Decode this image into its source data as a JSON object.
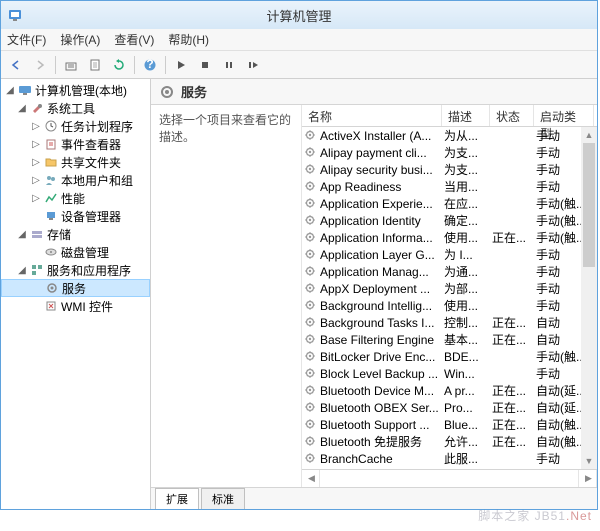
{
  "window": {
    "title": "计算机管理"
  },
  "menubar": {
    "file": "文件(F)",
    "action": "操作(A)",
    "view": "查看(V)",
    "help": "帮助(H)"
  },
  "tree": {
    "root": "计算机管理(本地)",
    "systools": "系统工具",
    "scheduler": "任务计划程序",
    "eventviewer": "事件查看器",
    "shared": "共享文件夹",
    "usersgroups": "本地用户和组",
    "perf": "性能",
    "devmgr": "设备管理器",
    "storage": "存储",
    "diskmgmt": "磁盘管理",
    "apps": "服务和应用程序",
    "services": "服务",
    "wmi": "WMI 控件"
  },
  "main": {
    "title": "服务",
    "detail": "选择一个项目来查看它的描述。",
    "columns": {
      "name": "名称",
      "desc": "描述",
      "status": "状态",
      "start": "启动类型"
    },
    "tabs": {
      "ext": "扩展",
      "std": "标准"
    }
  },
  "services": [
    {
      "name": "ActiveX Installer (A...",
      "desc": "为从...",
      "status": "",
      "start": "手动"
    },
    {
      "name": "Alipay payment cli...",
      "desc": "为支...",
      "status": "",
      "start": "手动"
    },
    {
      "name": "Alipay security busi...",
      "desc": "为支...",
      "status": "",
      "start": "手动"
    },
    {
      "name": "App Readiness",
      "desc": "当用...",
      "status": "",
      "start": "手动"
    },
    {
      "name": "Application Experie...",
      "desc": "在应...",
      "status": "",
      "start": "手动(触..."
    },
    {
      "name": "Application Identity",
      "desc": "确定...",
      "status": "",
      "start": "手动(触..."
    },
    {
      "name": "Application Informa...",
      "desc": "使用...",
      "status": "正在...",
      "start": "手动(触..."
    },
    {
      "name": "Application Layer G...",
      "desc": "为 I...",
      "status": "",
      "start": "手动"
    },
    {
      "name": "Application Manag...",
      "desc": "为通...",
      "status": "",
      "start": "手动"
    },
    {
      "name": "AppX Deployment ...",
      "desc": "为部...",
      "status": "",
      "start": "手动"
    },
    {
      "name": "Background Intellig...",
      "desc": "使用...",
      "status": "",
      "start": "手动"
    },
    {
      "name": "Background Tasks I...",
      "desc": "控制...",
      "status": "正在...",
      "start": "自动"
    },
    {
      "name": "Base Filtering Engine",
      "desc": "基本...",
      "status": "正在...",
      "start": "自动"
    },
    {
      "name": "BitLocker Drive Enc...",
      "desc": "BDE...",
      "status": "",
      "start": "手动(触..."
    },
    {
      "name": "Block Level Backup ...",
      "desc": "Win...",
      "status": "",
      "start": "手动"
    },
    {
      "name": "Bluetooth Device M...",
      "desc": "A pr...",
      "status": "正在...",
      "start": "自动(延..."
    },
    {
      "name": "Bluetooth OBEX Ser...",
      "desc": "Pro...",
      "status": "正在...",
      "start": "自动(延..."
    },
    {
      "name": "Bluetooth Support ...",
      "desc": "Blue...",
      "status": "正在...",
      "start": "自动(触..."
    },
    {
      "name": "Bluetooth 免提服务",
      "desc": "允许...",
      "status": "正在...",
      "start": "自动(触..."
    },
    {
      "name": "BranchCache",
      "desc": "此服...",
      "status": "",
      "start": "手动"
    }
  ],
  "watermark": {
    "a": "脚本之家 ",
    "b": "JB51",
    "c": ".Net"
  }
}
